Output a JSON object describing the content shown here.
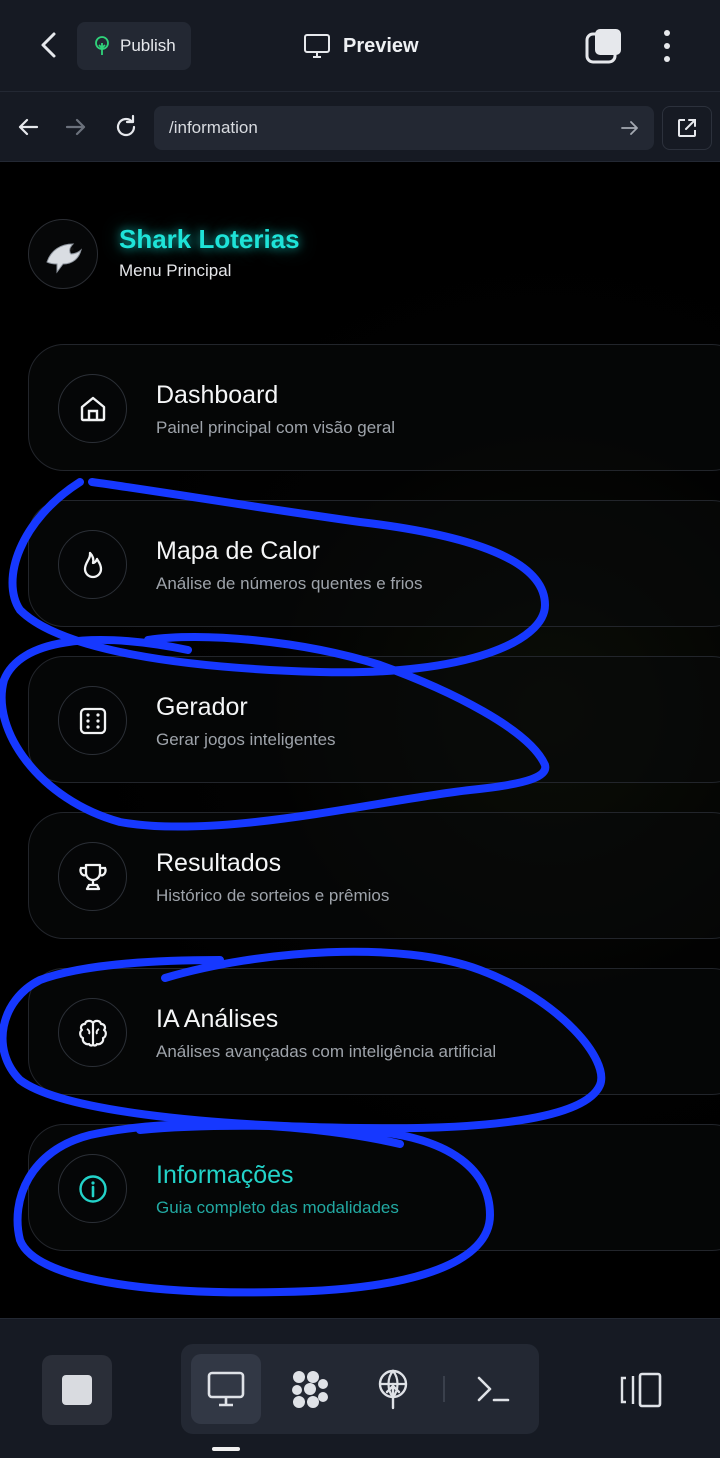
{
  "topbar": {
    "publish_label": "Publish",
    "preview_label": "Preview"
  },
  "urlbar": {
    "url": "/information"
  },
  "brand": {
    "title": "Shark Loterias",
    "subtitle": "Menu Principal",
    "logo_icon": "shark-logo-icon"
  },
  "menu": {
    "items": [
      {
        "title": "Dashboard",
        "description": "Painel principal com visão geral",
        "icon": "home-icon"
      },
      {
        "title": "Mapa de Calor",
        "description": "Análise de números quentes e frios",
        "icon": "flame-icon"
      },
      {
        "title": "Gerador",
        "description": "Gerar jogos inteligentes",
        "icon": "dice-icon"
      },
      {
        "title": "Resultados",
        "description": "Histórico de sorteios e prêmios",
        "icon": "trophy-icon"
      },
      {
        "title": "IA Análises",
        "description": "Análises avançadas com inteligência artificial",
        "icon": "brain-icon"
      },
      {
        "title": "Informações",
        "description": "Guia completo das modalidades",
        "icon": "info-icon",
        "active": true
      }
    ]
  },
  "colors": {
    "accent": "#1ee3d8",
    "annotation": "#1638ff",
    "bar_bg": "#161a23"
  }
}
